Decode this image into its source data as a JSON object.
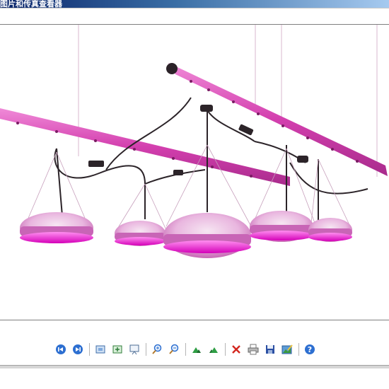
{
  "window": {
    "title": "图片和传真查看器"
  },
  "toolbar": {
    "buttons": [
      {
        "name": "previous-image-button",
        "icon": "previous-circle-icon",
        "tooltip": ""
      },
      {
        "name": "next-image-button",
        "icon": "next-circle-icon",
        "tooltip": ""
      },
      {
        "name": "best-fit-button",
        "icon": "best-fit-icon",
        "tooltip": ""
      },
      {
        "name": "actual-size-button",
        "icon": "actual-size-icon",
        "tooltip": ""
      },
      {
        "name": "slideshow-button",
        "icon": "slideshow-icon",
        "tooltip": ""
      },
      {
        "name": "zoom-in-button",
        "icon": "zoom-in-icon",
        "tooltip": ""
      },
      {
        "name": "zoom-out-button",
        "icon": "zoom-out-icon",
        "tooltip": ""
      },
      {
        "name": "rotate-clockwise-button",
        "icon": "rotate-clockwise-icon",
        "tooltip": ""
      },
      {
        "name": "rotate-counterclockwise-button",
        "icon": "rotate-counterclockwise-icon",
        "tooltip": ""
      },
      {
        "name": "delete-button",
        "icon": "delete-x-icon",
        "tooltip": ""
      },
      {
        "name": "print-button",
        "icon": "printer-icon",
        "tooltip": ""
      },
      {
        "name": "save-button",
        "icon": "floppy-disk-icon",
        "tooltip": ""
      },
      {
        "name": "edit-button",
        "icon": "edit-image-icon",
        "tooltip": ""
      },
      {
        "name": "help-button",
        "icon": "help-question-icon",
        "tooltip": ""
      }
    ]
  },
  "colors": {
    "accent": "#3a6ea5",
    "titlebar_dark": "#0a246a",
    "led_pink": "#e040c8",
    "rail_pink": "#d33fae"
  }
}
